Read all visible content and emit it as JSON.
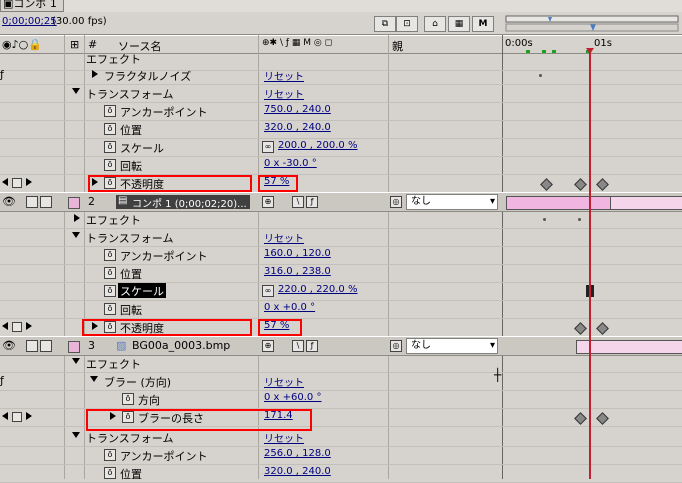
{
  "tab": {
    "label": "コンポ 1"
  },
  "toolbar": {
    "timecode": "0;00;00;25",
    "fps": "(30.00 fps)"
  },
  "columns": {
    "source_name": "ソース名",
    "parent": "親",
    "num": "#",
    "ruler_start": "0:00s",
    "ruler_mid": "01s"
  },
  "rows": {
    "effect1": "エフェクト",
    "fractal": "フラクタルノイズ",
    "fractal_reset": "リセット",
    "transform1": "トランスフォーム",
    "transform1_reset": "リセット",
    "anchor1_label": "アンカーポイント",
    "anchor1_val": "750.0 , 240.0",
    "pos1_label": "位置",
    "pos1_val": "320.0 , 240.0",
    "scale1_label": "スケール",
    "scale1_val": "200.0 , 200.0 %",
    "rot1_label": "回転",
    "rot1_val": "0 x -30.0 °",
    "opac1_label": "不透明度",
    "opac1_val": "57 %",
    "layer2_num": "2",
    "layer2_name": "コンポ 1 (0;00;02;20)...",
    "layer2_parent": "なし",
    "effect2": "エフェクト",
    "transform2": "トランスフォーム",
    "transform2_reset": "リセット",
    "anchor2_label": "アンカーポイント",
    "anchor2_val": "160.0 , 120.0",
    "pos2_label": "位置",
    "pos2_val": "316.0 , 238.0",
    "scale2_label": "スケール",
    "scale2_val": "220.0 , 220.0 %",
    "rot2_label": "回転",
    "rot2_val": "0 x +0.0 °",
    "opac2_label": "不透明度",
    "opac2_val": "57 %",
    "layer3_num": "3",
    "layer3_name": "BG00a_0003.bmp",
    "layer3_parent": "なし",
    "effect3": "エフェクト",
    "blur": "ブラー (方向)",
    "blur_reset": "リセット",
    "dir_label": "方向",
    "dir_val": "0 x +60.0 °",
    "bloblen_label": "ブラーの長さ",
    "bloblen_val": "171.4",
    "transform3": "トランスフォーム",
    "transform3_reset": "リセット",
    "anchor3_label": "アンカーポイント",
    "anchor3_val": "256.0 , 128.0",
    "pos3_label": "位置",
    "pos3_val": "320.0 , 240.0"
  },
  "colors": {
    "highlight_box": "#ff0000",
    "playhead": "#c02030",
    "layer_bar": "#f0b5e0",
    "value_link": "#00007f"
  }
}
